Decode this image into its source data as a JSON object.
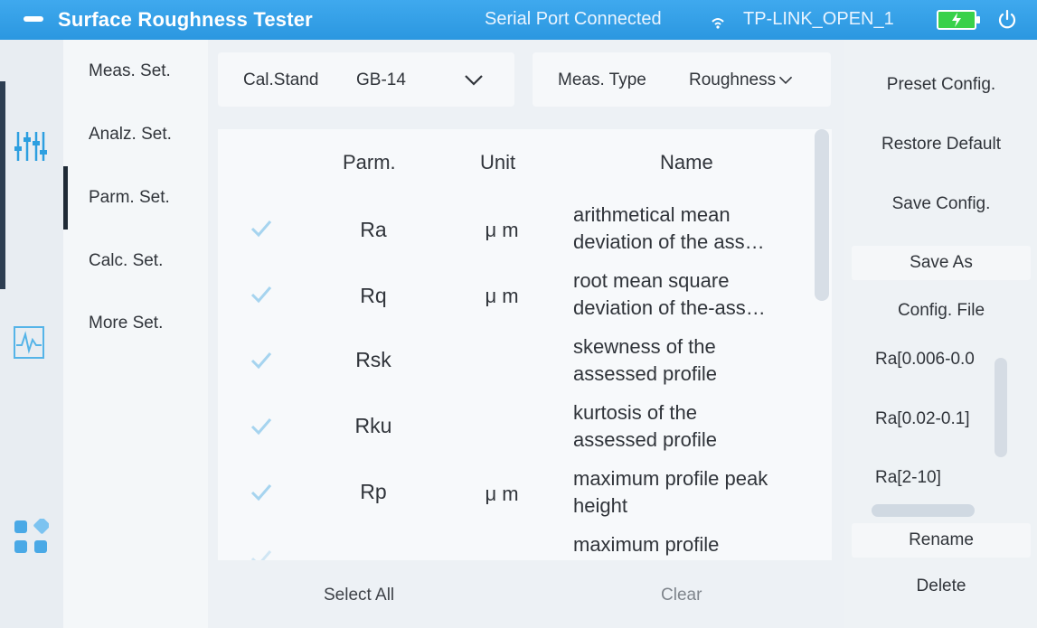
{
  "titlebar": {
    "app_title": "Surface Roughness Tester",
    "serial_status": "Serial Port Connected",
    "wifi_name": "TP-LINK_OPEN_1",
    "battery_color": "#39d14a",
    "accent_color": "#2e9be4"
  },
  "rail": {
    "icons": [
      "sliders-icon",
      "waveform-icon",
      "apps-grid-icon"
    ]
  },
  "nav": {
    "items": [
      {
        "label": "Meas. Set."
      },
      {
        "label": "Analz. Set."
      },
      {
        "label": "Parm. Set."
      },
      {
        "label": "Calc. Set."
      },
      {
        "label": "More Set."
      }
    ],
    "active_index": 2
  },
  "controls": {
    "cal_stand_label": "Cal.Stand",
    "cal_stand_value": "GB-14",
    "meas_type_label": "Meas. Type",
    "meas_type_value": "Roughness"
  },
  "table": {
    "headers": {
      "parm": "Parm.",
      "unit": "Unit",
      "name": "Name"
    },
    "rows": [
      {
        "checked": true,
        "parm": "Ra",
        "unit": "μ m",
        "name1": "arithmetical mean",
        "name2": "deviation of the ass…"
      },
      {
        "checked": true,
        "parm": "Rq",
        "unit": "μ m",
        "name1": "root mean square",
        "name2": "deviation of the-ass…"
      },
      {
        "checked": true,
        "parm": "Rsk",
        "unit": "",
        "name1": "skewness of the",
        "name2": "assessed profile"
      },
      {
        "checked": true,
        "parm": "Rku",
        "unit": "",
        "name1": "kurtosis of the",
        "name2": "assessed profile"
      },
      {
        "checked": true,
        "parm": "Rp",
        "unit": "μ m",
        "name1": "maximum profile peak",
        "name2": "height"
      },
      {
        "checked": true,
        "parm": "",
        "unit": "",
        "name1": "maximum profile",
        "name2": ""
      }
    ]
  },
  "bottom": {
    "select_all": "Select All",
    "clear": "Clear"
  },
  "right": {
    "preset_config": "Preset Config.",
    "restore_default": "Restore Default",
    "save_config": "Save Config.",
    "save_as": "Save As",
    "config_file": "Config. File",
    "presets": [
      "Ra[0.006-0.0",
      "Ra[0.02-0.1]",
      "Ra[2-10]"
    ],
    "rename": "Rename",
    "delete": "Delete"
  }
}
